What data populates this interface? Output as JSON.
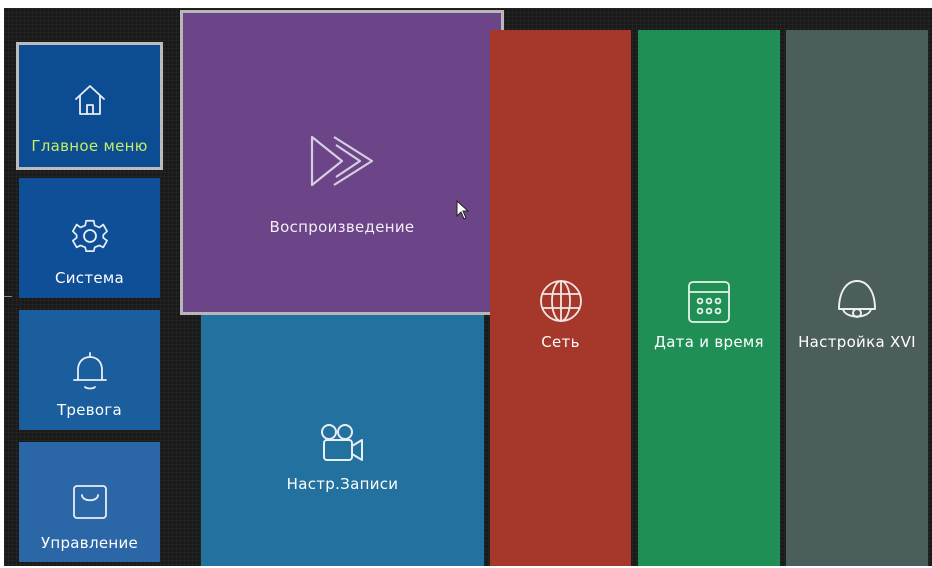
{
  "sidebar": {
    "items": [
      {
        "label": "Главное меню",
        "icon": "home-icon",
        "selected": true
      },
      {
        "label": "Система",
        "icon": "gear-icon"
      },
      {
        "label": "Тревога",
        "icon": "bell-icon"
      },
      {
        "label": "Управление",
        "icon": "bag-icon"
      }
    ]
  },
  "tiles": {
    "playback": {
      "label": "Воспроизведение",
      "icon": "fast-forward-icon",
      "highlighted": true
    },
    "record": {
      "label": "Настр.Записи",
      "icon": "video-camera-icon"
    },
    "network": {
      "label": "Сеть",
      "icon": "globe-icon"
    },
    "datetime": {
      "label": "Дата и время",
      "icon": "calendar-icon"
    },
    "xvi": {
      "label": "Настройка XVI",
      "icon": "dome-camera-icon"
    }
  },
  "colors": {
    "selected_label": "#c7ed62",
    "playback": "#6c4488",
    "record": "#23719f",
    "network": "#a6372b",
    "datetime": "#1f8f55",
    "xvi": "#4c5e5b",
    "sidebar": "#0c4c93"
  }
}
